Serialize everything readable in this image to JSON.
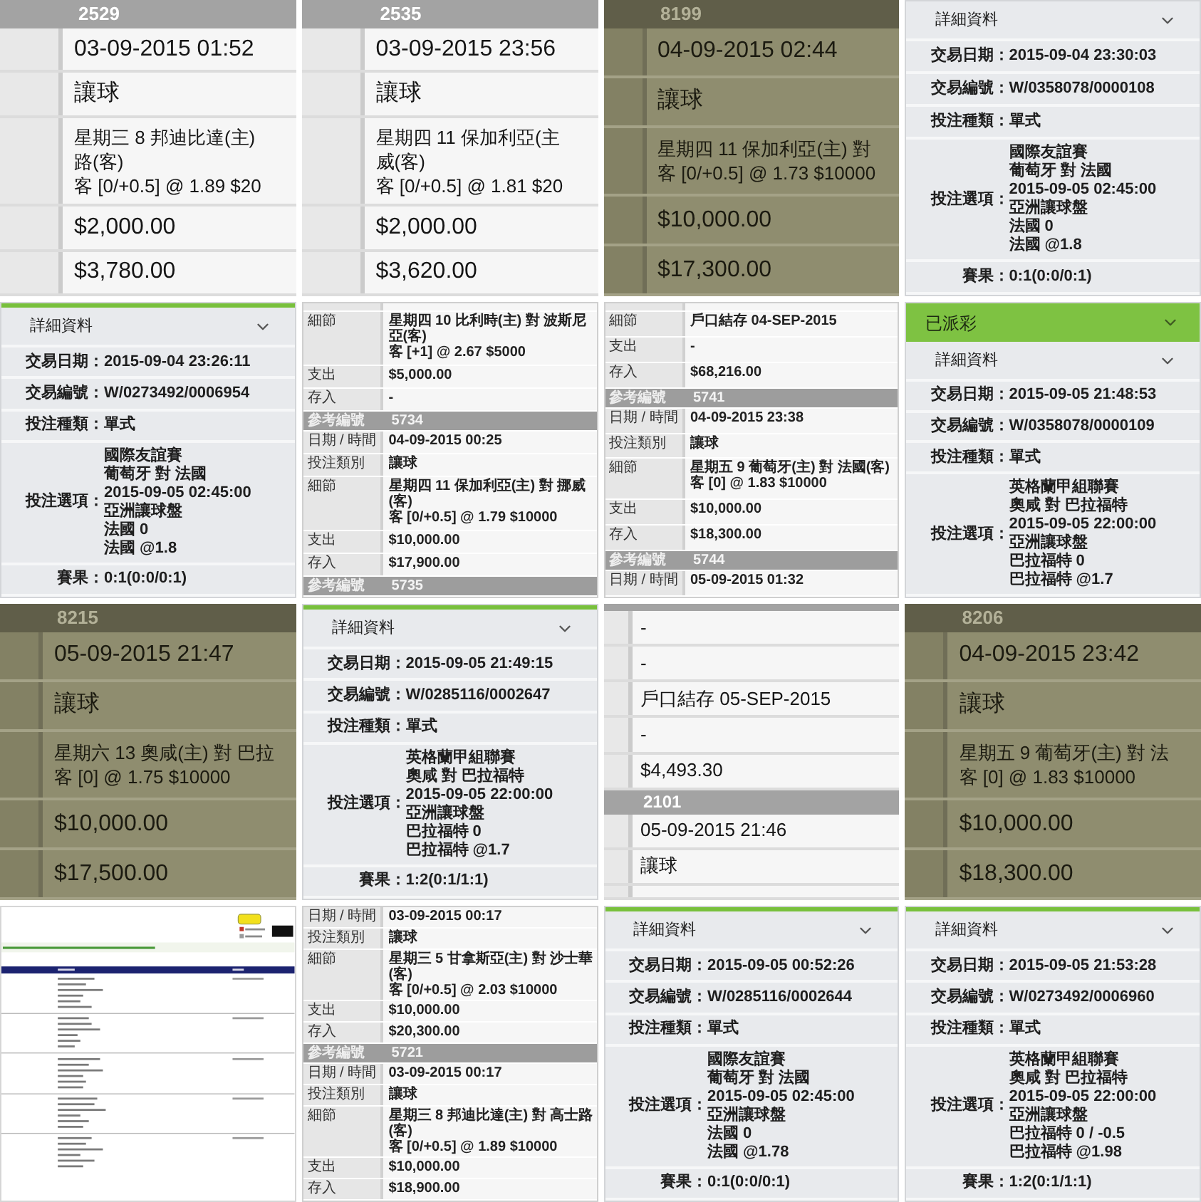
{
  "tiles": [
    {
      "kind": "statement",
      "tinted": false,
      "rows": [
        {
          "kind": "header",
          "text": "2529"
        },
        {
          "kind": "data",
          "lines": [
            "03-09-2015 01:52"
          ]
        },
        {
          "kind": "data",
          "lines": [
            "讓球"
          ]
        },
        {
          "kind": "data",
          "lines": [
            "星期三 8 邦迪比達(主)",
            "路(客)",
            "客 [0/+0.5] @ 1.89 $20"
          ]
        },
        {
          "kind": "data",
          "lines": [
            "$2,000.00"
          ]
        },
        {
          "kind": "data",
          "lines": [
            "$3,780.00"
          ]
        }
      ]
    },
    {
      "kind": "statement",
      "tinted": false,
      "rows": [
        {
          "kind": "header",
          "text": "2535"
        },
        {
          "kind": "data",
          "lines": [
            "03-09-2015 23:56"
          ]
        },
        {
          "kind": "data",
          "lines": [
            "讓球"
          ]
        },
        {
          "kind": "data",
          "lines": [
            "星期四 11 保加利亞(主",
            "威(客)",
            "客 [0/+0.5] @ 1.81 $20"
          ]
        },
        {
          "kind": "data",
          "lines": [
            "$2,000.00"
          ]
        },
        {
          "kind": "data",
          "lines": [
            "$3,620.00"
          ]
        }
      ]
    },
    {
      "kind": "statement",
      "tinted": true,
      "rows": [
        {
          "kind": "header",
          "text": "8199"
        },
        {
          "kind": "data",
          "lines": [
            "04-09-2015 02:44"
          ]
        },
        {
          "kind": "data",
          "lines": [
            "讓球"
          ]
        },
        {
          "kind": "data",
          "lines": [
            "星期四 11 保加利亞(主) 對",
            "客 [0/+0.5] @ 1.73 $10000"
          ]
        },
        {
          "kind": "data",
          "lines": [
            "$10,000.00"
          ]
        },
        {
          "kind": "data",
          "lines": [
            "$17,300.00"
          ]
        }
      ]
    },
    {
      "kind": "details",
      "top_accent": false,
      "title": "詳細資料",
      "fields": [
        {
          "kind": "field",
          "label": "交易日期：",
          "value": "2015-09-04 23:30:03"
        },
        {
          "kind": "field",
          "label": "交易編號：",
          "value": "W/0358078/0000108"
        },
        {
          "kind": "field",
          "label": "投注種類：",
          "value": "單式"
        },
        {
          "kind": "selection",
          "label": "投注選項：",
          "lines": [
            "國際友誼賽",
            "葡萄牙 對 法國",
            "2015-09-05 02:45:00",
            "亞洲讓球盤",
            "法國 0",
            "法國 @1.8"
          ]
        },
        {
          "kind": "field",
          "label": "賽果：",
          "value": "0:1(0:0/0:1)"
        }
      ]
    },
    {
      "kind": "details",
      "top_accent": true,
      "title": "詳細資料",
      "fields": [
        {
          "kind": "field",
          "label": "交易日期：",
          "value": "2015-09-04 23:26:11"
        },
        {
          "kind": "field",
          "label": "交易編號：",
          "value": "W/0273492/0006954"
        },
        {
          "kind": "field",
          "label": "投注種類：",
          "value": "單式"
        },
        {
          "kind": "selection",
          "label": "投注選項：",
          "lines": [
            "國際友誼賽",
            "葡萄牙 對 法國",
            "2015-09-05 02:45:00",
            "亞洲讓球盤",
            "法國 0",
            "法國 @1.8"
          ]
        },
        {
          "kind": "field",
          "label": "賽果：",
          "value": "0:1(0:0/0:1)"
        }
      ]
    },
    {
      "kind": "ledger",
      "rows": [
        {
          "kind": "blank"
        },
        {
          "kind": "data",
          "label": "細節",
          "lines": [
            "星期四 10 比利時(主) 對 波斯尼亞(客)",
            "客 [+1] @ 2.67 $5000"
          ]
        },
        {
          "kind": "data",
          "label": "支出",
          "lines": [
            "$5,000.00"
          ]
        },
        {
          "kind": "data",
          "label": "存入",
          "lines": [
            "-"
          ]
        },
        {
          "kind": "header",
          "label": "參考編號",
          "value": "5734"
        },
        {
          "kind": "data",
          "label": "日期 / 時間",
          "lines": [
            "04-09-2015 00:25"
          ]
        },
        {
          "kind": "data",
          "label": "投注類別",
          "lines": [
            "讓球"
          ]
        },
        {
          "kind": "data",
          "label": "細節",
          "lines": [
            "星期四 11 保加利亞(主) 對 挪威(客)",
            "客 [0/+0.5] @ 1.79 $10000"
          ]
        },
        {
          "kind": "data",
          "label": "支出",
          "lines": [
            "$10,000.00"
          ]
        },
        {
          "kind": "data",
          "label": "存入",
          "lines": [
            "$17,900.00"
          ]
        },
        {
          "kind": "header",
          "label": "參考編號",
          "value": "5735"
        }
      ]
    },
    {
      "kind": "ledger",
      "rows": [
        {
          "kind": "blank"
        },
        {
          "kind": "data",
          "label": "細節",
          "lines": [
            "戶口結存 04-SEP-2015"
          ]
        },
        {
          "kind": "data",
          "label": "支出",
          "lines": [
            "-"
          ]
        },
        {
          "kind": "data",
          "label": "存入",
          "lines": [
            "$68,216.00"
          ]
        },
        {
          "kind": "header",
          "label": "參考編號",
          "value": "5741"
        },
        {
          "kind": "data",
          "label": "日期 / 時間",
          "lines": [
            "04-09-2015 23:38"
          ]
        },
        {
          "kind": "data",
          "label": "投注類別",
          "lines": [
            "讓球"
          ]
        },
        {
          "kind": "data",
          "label": "細節",
          "lines": [
            "星期五 9 葡萄牙(主) 對 法國(客)",
            "客 [0] @ 1.83 $10000"
          ]
        },
        {
          "kind": "data",
          "label": "支出",
          "lines": [
            "$10,000.00"
          ]
        },
        {
          "kind": "data",
          "label": "存入",
          "lines": [
            "$18,300.00"
          ]
        },
        {
          "kind": "header",
          "label": "參考編號",
          "value": "5744"
        },
        {
          "kind": "data",
          "label": "日期 / 時間",
          "lines": [
            "05-09-2015 01:32"
          ]
        }
      ]
    },
    {
      "kind": "details",
      "top_accent": false,
      "status": "已派彩",
      "title": "詳細資料",
      "fields": [
        {
          "kind": "field",
          "label": "交易日期：",
          "value": "2015-09-05 21:48:53"
        },
        {
          "kind": "field",
          "label": "交易編號：",
          "value": "W/0358078/0000109"
        },
        {
          "kind": "field",
          "label": "投注種類：",
          "value": "單式"
        },
        {
          "kind": "selection",
          "label": "投注選項：",
          "lines": [
            "英格蘭甲組聯賽",
            "奧咸 對 巴拉福特",
            "2015-09-05 22:00:00",
            "亞洲讓球盤",
            "巴拉福特 0",
            "巴拉福特 @1.7"
          ]
        }
      ]
    },
    {
      "kind": "statement",
      "tinted": true,
      "rows": [
        {
          "kind": "header",
          "text": "8215"
        },
        {
          "kind": "data",
          "lines": [
            "05-09-2015 21:47"
          ]
        },
        {
          "kind": "data",
          "lines": [
            "讓球"
          ]
        },
        {
          "kind": "data",
          "lines": [
            "星期六 13 奧咸(主) 對 巴拉",
            "客 [0] @ 1.75 $10000"
          ]
        },
        {
          "kind": "data",
          "lines": [
            "$10,000.00"
          ]
        },
        {
          "kind": "data",
          "lines": [
            "$17,500.00"
          ]
        }
      ]
    },
    {
      "kind": "details",
      "top_accent": true,
      "title": "詳細資料",
      "fields": [
        {
          "kind": "field",
          "label": "交易日期：",
          "value": "2015-09-05 21:49:15"
        },
        {
          "kind": "field",
          "label": "交易編號：",
          "value": "W/0285116/0002647"
        },
        {
          "kind": "field",
          "label": "投注種類：",
          "value": "單式"
        },
        {
          "kind": "selection",
          "label": "投注選項：",
          "lines": [
            "英格蘭甲組聯賽",
            "奧咸 對 巴拉福特",
            "2015-09-05 22:00:00",
            "亞洲讓球盤",
            "巴拉福特 0",
            "巴拉福特 @1.7"
          ]
        },
        {
          "kind": "field",
          "label": "賽果：",
          "value": "1:2(0:1/1:1)"
        }
      ]
    },
    {
      "kind": "statement",
      "tinted": false,
      "rows": [
        {
          "kind": "header"
        },
        {
          "kind": "data",
          "lines": [
            "-"
          ]
        },
        {
          "kind": "data",
          "lines": [
            "-"
          ]
        },
        {
          "kind": "data",
          "lines": [
            "戶口結存 05-SEP-2015"
          ]
        },
        {
          "kind": "data",
          "lines": [
            "-"
          ]
        },
        {
          "kind": "data",
          "lines": [
            "$4,493.30"
          ]
        },
        {
          "kind": "header",
          "text": "2101"
        },
        {
          "kind": "data",
          "lines": [
            "05-09-2015 21:46"
          ]
        },
        {
          "kind": "data",
          "lines": [
            "讓球"
          ]
        },
        {
          "kind": "blank"
        }
      ]
    },
    {
      "kind": "statement",
      "tinted": true,
      "rows": [
        {
          "kind": "header",
          "text": "8206"
        },
        {
          "kind": "data",
          "lines": [
            "04-09-2015 23:42"
          ]
        },
        {
          "kind": "data",
          "lines": [
            "讓球"
          ]
        },
        {
          "kind": "data",
          "lines": [
            "星期五 9 葡萄牙(主) 對 法",
            "客 [0] @ 1.83 $10000"
          ]
        },
        {
          "kind": "data",
          "lines": [
            "$10,000.00"
          ]
        },
        {
          "kind": "data",
          "lines": [
            "$18,300.00"
          ]
        }
      ]
    },
    {
      "kind": "screenshot"
    },
    {
      "kind": "ledger",
      "rows": [
        {
          "kind": "data",
          "label": "日期 / 時間",
          "lines": [
            "03-09-2015 00:17"
          ]
        },
        {
          "kind": "data",
          "label": "投注類別",
          "lines": [
            "讓球"
          ]
        },
        {
          "kind": "data",
          "label": "細節",
          "lines": [
            "星期三 5 甘拿斯亞(主) 對 沙士華(客)",
            "客 [0/+0.5] @ 2.03 $10000"
          ]
        },
        {
          "kind": "data",
          "label": "支出",
          "lines": [
            "$10,000.00"
          ]
        },
        {
          "kind": "data",
          "label": "存入",
          "lines": [
            "$20,300.00"
          ]
        },
        {
          "kind": "header",
          "label": "參考編號",
          "value": "5721"
        },
        {
          "kind": "data",
          "label": "日期 / 時間",
          "lines": [
            "03-09-2015 00:17"
          ]
        },
        {
          "kind": "data",
          "label": "投注類別",
          "lines": [
            "讓球"
          ]
        },
        {
          "kind": "data",
          "label": "細節",
          "lines": [
            "星期三 8 邦迪比達(主) 對 高士路(客)",
            "客 [0/+0.5] @ 1.89 $10000"
          ]
        },
        {
          "kind": "data",
          "label": "支出",
          "lines": [
            "$10,000.00"
          ]
        },
        {
          "kind": "data",
          "label": "存入",
          "lines": [
            "$18,900.00"
          ]
        }
      ]
    },
    {
      "kind": "details",
      "top_accent": true,
      "title": "詳細資料",
      "fields": [
        {
          "kind": "field",
          "label": "交易日期：",
          "value": "2015-09-05 00:52:26"
        },
        {
          "kind": "field",
          "label": "交易編號：",
          "value": "W/0285116/0002644"
        },
        {
          "kind": "field",
          "label": "投注種類：",
          "value": "單式"
        },
        {
          "kind": "selection",
          "label": "投注選項：",
          "lines": [
            "國際友誼賽",
            "葡萄牙 對 法國",
            "2015-09-05 02:45:00",
            "亞洲讓球盤",
            "法國 0",
            "法國 @1.78"
          ]
        },
        {
          "kind": "field",
          "label": "賽果：",
          "value": "0:1(0:0/0:1)"
        }
      ]
    },
    {
      "kind": "details",
      "top_accent": true,
      "title": "詳細資料",
      "fields": [
        {
          "kind": "field",
          "label": "交易日期：",
          "value": "2015-09-05 21:53:28"
        },
        {
          "kind": "field",
          "label": "交易編號：",
          "value": "W/0273492/0006960"
        },
        {
          "kind": "field",
          "label": "投注種類：",
          "value": "單式"
        },
        {
          "kind": "selection",
          "label": "投注選項：",
          "lines": [
            "英格蘭甲組聯賽",
            "奧咸 對 巴拉福特",
            "2015-09-05 22:00:00",
            "亞洲讓球盤",
            "巴拉福特 0 / -0.5",
            "巴拉福特 @1.98"
          ]
        },
        {
          "kind": "field",
          "label": "賽果：",
          "value": "1:2(0:1/1:1)"
        }
      ]
    }
  ]
}
